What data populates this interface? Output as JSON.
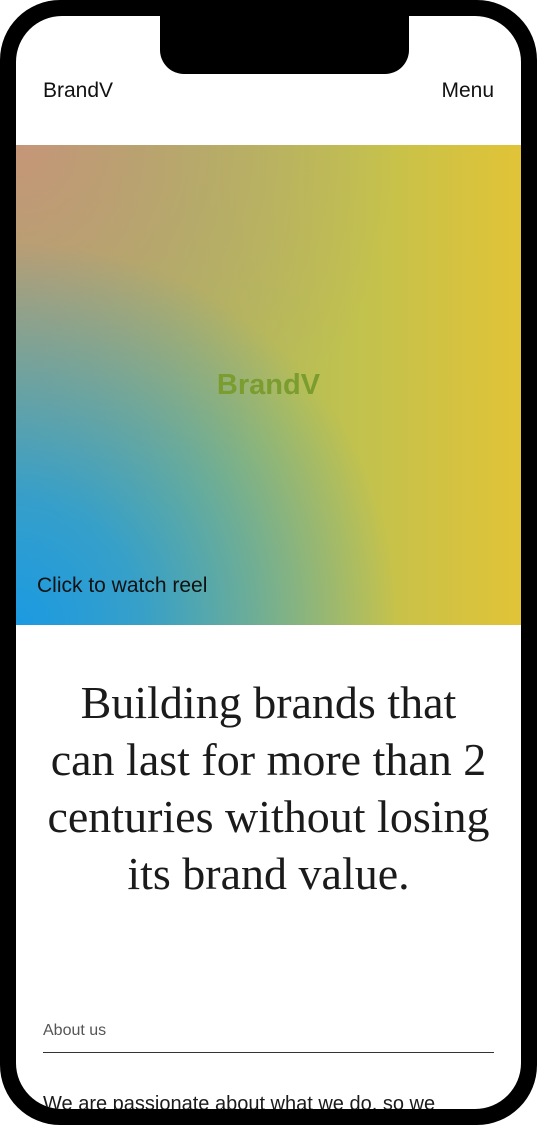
{
  "header": {
    "logo": "BrandV",
    "menu_label": "Menu"
  },
  "hero": {
    "brand_text": "BrandV",
    "cta_label": "Click to watch reel"
  },
  "headline": "Building brands that can last for more than 2 centuries without losing its brand value.",
  "about": {
    "label": "About us",
    "body": "We are passionate about what we do, so we"
  }
}
